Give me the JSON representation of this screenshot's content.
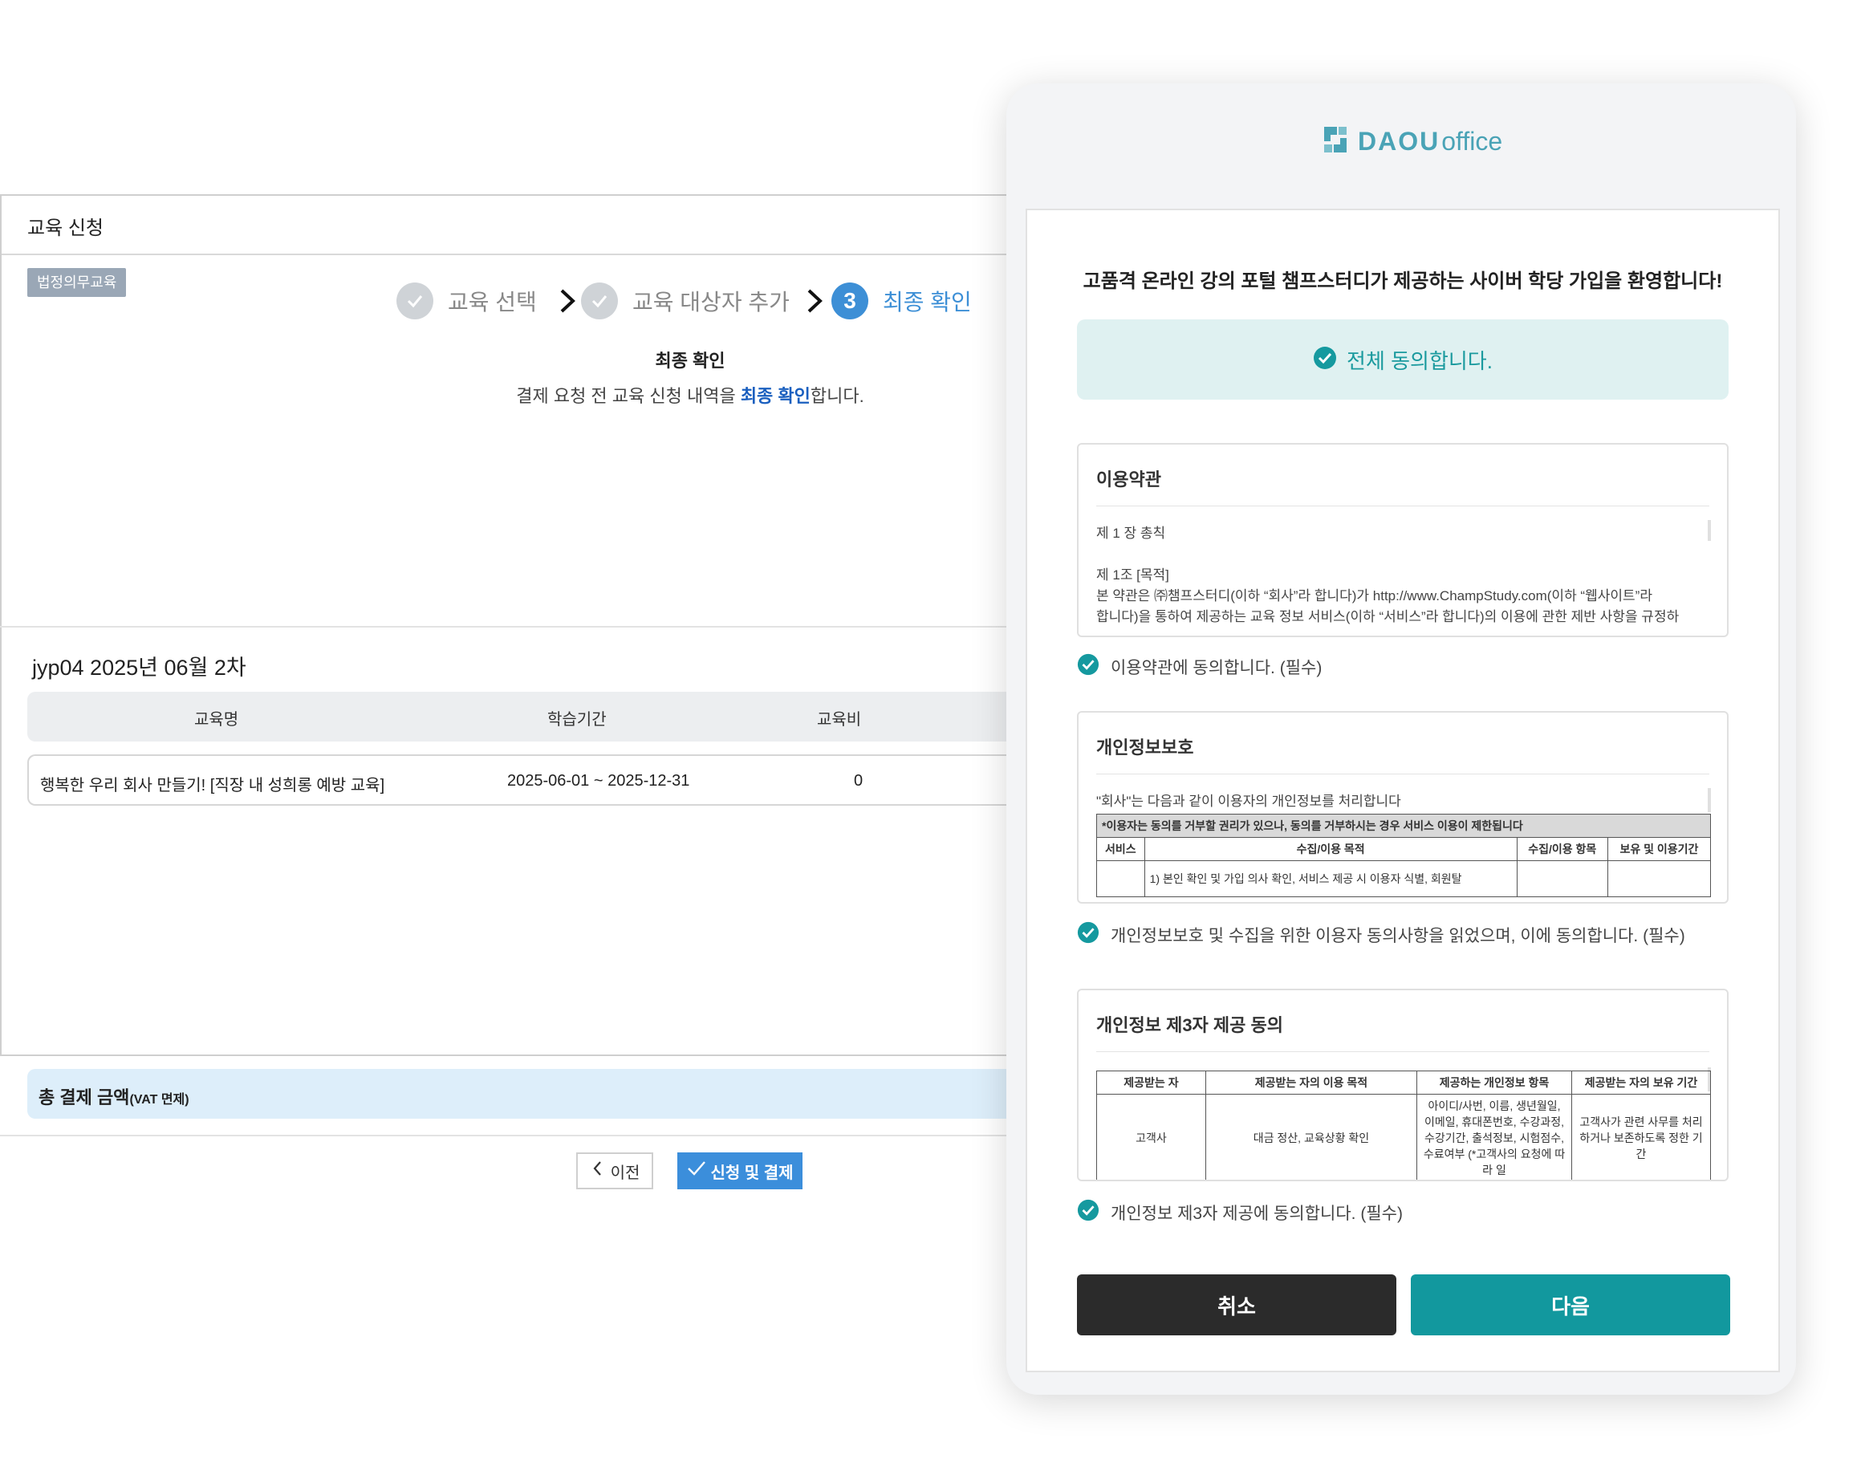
{
  "left": {
    "window_title": "교육 신청",
    "badge": "법정의무교육",
    "steps": [
      {
        "label": "교육 선택",
        "state": "done"
      },
      {
        "label": "교육 대상자 추가",
        "state": "done"
      },
      {
        "number": "3",
        "label": "최종 확인",
        "state": "active"
      }
    ],
    "confirm_heading": "최종 확인",
    "confirm_desc_before": "결제 요청 전 교육 신청 내역을 ",
    "confirm_desc_highlight": "최종 확인",
    "confirm_desc_after": "합니다.",
    "group_title": "jyp04 2025년 06월 2차",
    "table": {
      "headers": [
        "교육명",
        "학습기간",
        "교육비"
      ],
      "rows": [
        {
          "name": "행복한 우리 회사 만들기! [직장 내 성희롱 예방 교육]",
          "period": "2025-06-01 ~ 2025-12-31",
          "fee": "0"
        }
      ]
    },
    "total_label": "총 결제 금액",
    "total_note": "(VAT 면제)",
    "prev_button": "이전",
    "submit_button": "신청 및 결제"
  },
  "modal": {
    "logo_bold": "DAOU",
    "logo_light": "office",
    "welcome": "고품격 온라인 강의 포털 챔프스터디가 제공하는 사이버 학당 가입을 환영합니다!",
    "agree_all": "전체 동의합니다.",
    "terms": {
      "title": "이용약관",
      "chapter": "제 1 장 총칙",
      "article": "제 1조 [목적]",
      "line1": "본 약관은 ㈜챔프스터디(이하 “회사”라 합니다)가 http://www.ChampStudy.com(이하 “웹사이트”라",
      "line2": "합니다)을 통하여 제공하는 교육 정보 서비스(이하 “서비스”라 합니다)의 이용에 관한 제반 사항을 규정하",
      "check": "이용약관에 동의합니다. (필수)"
    },
    "privacy": {
      "title": "개인정보보호",
      "intro": "\"회사\"는 다음과 같이 이용자의 개인정보를 처리합니다",
      "notice": "*이용자는 동의를 거부할 권리가 있으나, 동의를 거부하시는 경우 서비스 이용이 제한됩니다",
      "headers": [
        "서비스",
        "수집/이용 목적",
        "수집/이용 항목",
        "보유 및 이용기간"
      ],
      "row_purpose": "1) 본인 확인 및 가입 의사 확인, 서비스 제공 시 이용자 식별, 회원탈",
      "check": "개인정보보호 및 수집을 위한 이용자 동의사항을 읽었으며, 이에 동의합니다. (필수)"
    },
    "third_party": {
      "title": "개인정보 제3자 제공 동의",
      "headers": [
        "제공받는 자",
        "제공받는 자의 이용 목적",
        "제공하는 개인정보 항목",
        "제공받는 자의 보유 기간"
      ],
      "row": [
        "고객사",
        "대금 정산, 교육상황 확인",
        "아이디/사번, 이름, 생년월일, 이메일, 휴대폰번호, 수강과정, 수강기간, 출석정보, 시험점수, 수료여부 (*고객사의 요청에 따라 일",
        "고객사가 관련 사무를 처리하거나 보존하도록 정한 기간"
      ],
      "check": "개인정보 제3자 제공에 동의합니다. (필수)"
    },
    "cancel_button": "취소",
    "next_button": "다음"
  },
  "colors": {
    "accent_blue": "#3d8fd6",
    "teal": "#12989e",
    "check_teal": "#15999f"
  },
  "icons": [
    "check-icon",
    "chevron-right-icon",
    "chevron-left-icon",
    "check-circle-icon",
    "daou-logo-icon"
  ]
}
